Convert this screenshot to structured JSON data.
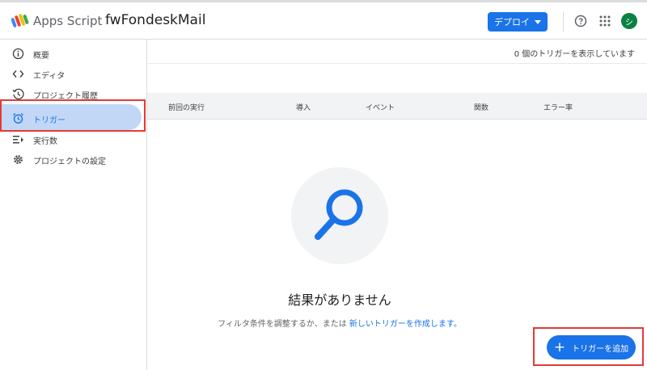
{
  "header": {
    "app_name": "Apps Script",
    "project_name": "fwFondeskMail",
    "deploy_label": "デプロイ",
    "avatar_initial": "シ"
  },
  "sidebar": {
    "items": [
      {
        "label": "概要",
        "icon": "info-icon"
      },
      {
        "label": "エディタ",
        "icon": "code-icon"
      },
      {
        "label": "プロジェクト履歴",
        "icon": "history-icon"
      },
      {
        "label": "トリガー",
        "icon": "alarm-clock-icon",
        "active": true
      },
      {
        "label": "実行数",
        "icon": "executions-icon"
      },
      {
        "label": "プロジェクトの設定",
        "icon": "gear-icon"
      }
    ]
  },
  "main": {
    "trigger_count_text": "0 個のトリガーを表示しています",
    "columns": [
      "前回の実行",
      "導入",
      "イベント",
      "関数",
      "エラー率"
    ],
    "empty": {
      "title": "結果がありません",
      "desc_prefix": "フィルタ条件を調整するか、または ",
      "desc_link": "新しいトリガーを作成します。"
    },
    "add_trigger_label": "トリガーを追加"
  },
  "colors": {
    "accent": "#1a73e8",
    "active_nav_bg": "#c2d7f5",
    "annotation_red": "#e53935"
  }
}
